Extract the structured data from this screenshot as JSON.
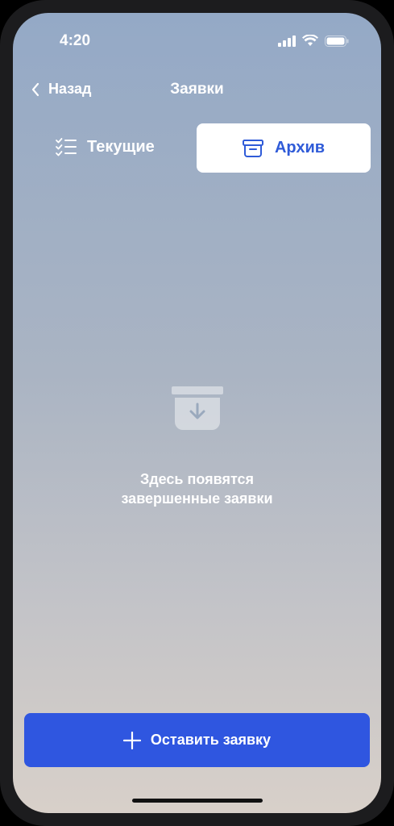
{
  "status_bar": {
    "time": "4:20"
  },
  "nav": {
    "back_label": "Назад",
    "title": "Заявки"
  },
  "tabs": [
    {
      "label": "Текущие",
      "icon": "checklist-icon",
      "selected": false
    },
    {
      "label": "Архив",
      "icon": "archive-box-icon",
      "selected": true
    }
  ],
  "empty_state": {
    "icon": "archive-download-icon",
    "line1": "Здесь появятся",
    "line2": "завершенные заявки"
  },
  "cta": {
    "label": "Оставить заявку",
    "icon": "plus-icon"
  },
  "colors": {
    "accent": "#2f56e0",
    "tab_selected_text": "#2f5bd8",
    "background_top": "#94a9c6",
    "background_bottom": "#d8d0c9"
  }
}
